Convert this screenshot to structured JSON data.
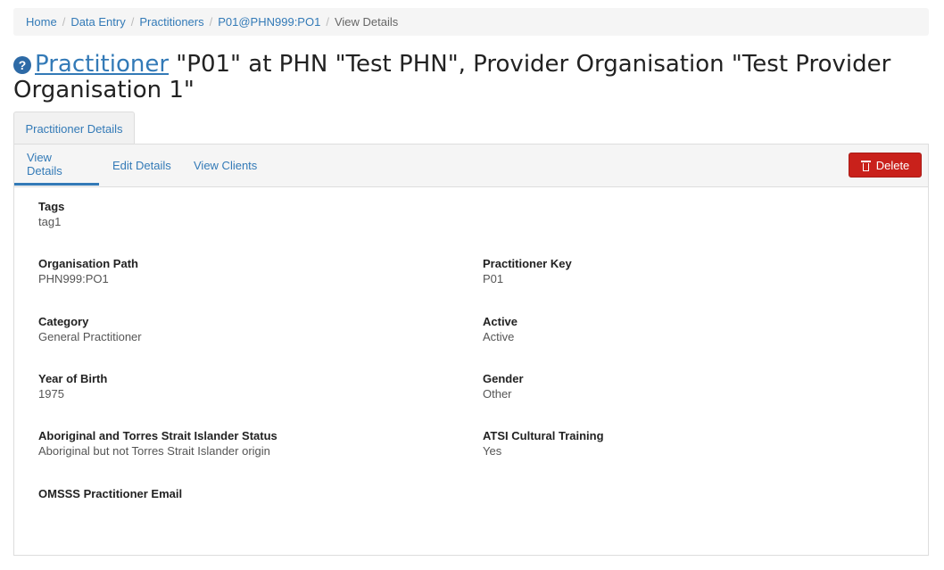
{
  "breadcrumb": {
    "items": [
      "Home",
      "Data Entry",
      "Practitioners",
      "P01@PHN999:PO1"
    ],
    "current": "View Details"
  },
  "heading": {
    "help_icon": "?",
    "link": "Practitioner",
    "rest": " \"P01\" at PHN \"Test PHN\", Provider Organisation \"Test Provider Organisation 1\""
  },
  "outer_tab": "Practitioner Details",
  "subtabs": [
    "View Details",
    "Edit Details",
    "View Clients"
  ],
  "delete_label": "Delete",
  "fields": {
    "tags": {
      "label": "Tags",
      "value": "tag1"
    },
    "org_path": {
      "label": "Organisation Path",
      "value": "PHN999:PO1"
    },
    "practitioner_key": {
      "label": "Practitioner Key",
      "value": "P01"
    },
    "category": {
      "label": "Category",
      "value": "General Practitioner"
    },
    "active": {
      "label": "Active",
      "value": "Active"
    },
    "year_of_birth": {
      "label": "Year of Birth",
      "value": "1975"
    },
    "gender": {
      "label": "Gender",
      "value": "Other"
    },
    "atsi_status": {
      "label": "Aboriginal and Torres Strait Islander Status",
      "value": "Aboriginal but not Torres Strait Islander origin"
    },
    "atsi_training": {
      "label": "ATSI Cultural Training",
      "value": "Yes"
    },
    "omsss_email": {
      "label": "OMSSS Practitioner Email",
      "value": ""
    }
  },
  "colors": {
    "link": "#337ab7",
    "delete": "#c9211b"
  }
}
